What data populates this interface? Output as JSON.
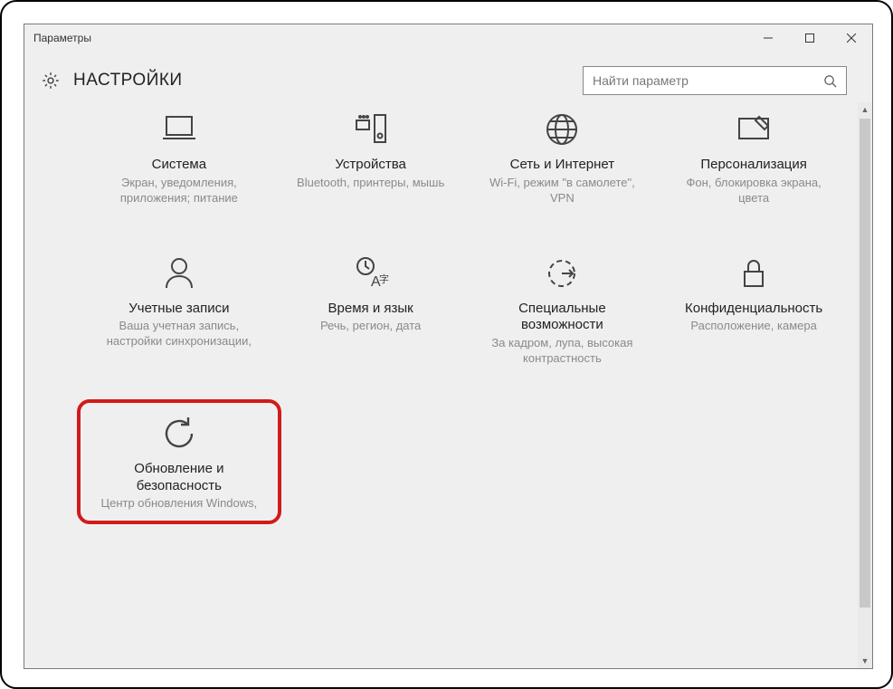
{
  "window": {
    "title": "Параметры"
  },
  "header": {
    "title": "НАСТРОЙКИ"
  },
  "search": {
    "placeholder": "Найти параметр"
  },
  "tiles": {
    "system": {
      "title": "Система",
      "desc": "Экран, уведомления, приложения; питание"
    },
    "devices": {
      "title": "Устройства",
      "desc": "Bluetooth, принтеры, мышь"
    },
    "network": {
      "title": "Сеть и Интернет",
      "desc": "Wi-Fi, режим \"в самолете\", VPN"
    },
    "personal": {
      "title": "Персонализация",
      "desc": "Фон, блокировка экрана, цвета"
    },
    "accounts": {
      "title": "Учетные записи",
      "desc": "Ваша учетная запись, настройки синхронизации,"
    },
    "timelang": {
      "title": "Время и язык",
      "desc": "Речь, регион, дата"
    },
    "ease": {
      "title": "Специальные возможности",
      "desc": "За кадром, лупа, высокая контрастность"
    },
    "privacy": {
      "title": "Конфиденциальность",
      "desc": "Расположение, камера"
    },
    "update": {
      "title": "Обновление и безопасность",
      "desc": "Центр обновления Windows,"
    }
  }
}
